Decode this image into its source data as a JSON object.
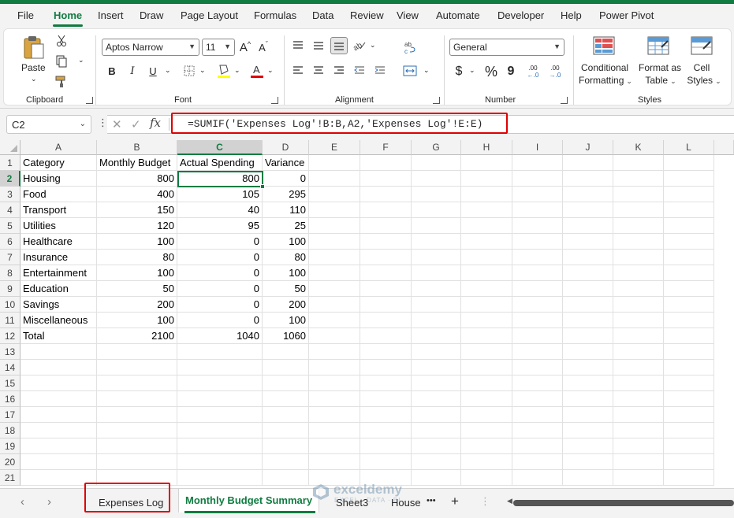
{
  "menu": {
    "tabs": [
      "File",
      "Home",
      "Insert",
      "Draw",
      "Page Layout",
      "Formulas",
      "Data",
      "Review",
      "View",
      "Automate",
      "Developer",
      "Help",
      "Power Pivot"
    ],
    "active": "Home"
  },
  "ribbon": {
    "clipboard": {
      "label": "Clipboard",
      "paste_label": "Paste"
    },
    "font": {
      "label": "Font",
      "font_name": "Aptos Narrow",
      "font_size": "11",
      "bold": "B",
      "italic": "I",
      "underline": "U",
      "grow": "A",
      "shrink": "A"
    },
    "alignment": {
      "label": "Alignment"
    },
    "number": {
      "label": "Number",
      "format": "General",
      "currency": "$",
      "percent": "%",
      "comma": "9",
      "inc_decimal": ".00",
      "dec_decimal": ".00"
    },
    "styles": {
      "label": "Styles",
      "conditional_line1": "Conditional",
      "conditional_line2": "Formatting",
      "format_table_line1": "Format as",
      "format_table_line2": "Table",
      "cell_styles_line1": "Cell",
      "cell_styles_line2": "Styles"
    }
  },
  "formula_bar": {
    "name_box": "C2",
    "fx": "fx",
    "formula": "=SUMIF('Expenses Log'!B:B,A2,'Expenses Log'!E:E)"
  },
  "grid": {
    "columns": [
      "A",
      "B",
      "C",
      "D",
      "E",
      "F",
      "G",
      "H",
      "I",
      "J",
      "K",
      "L"
    ],
    "row_numbers": [
      "1",
      "2",
      "3",
      "4",
      "5",
      "6",
      "7",
      "8",
      "9",
      "10",
      "11",
      "12",
      "13",
      "14",
      "15",
      "16",
      "17",
      "18",
      "19",
      "20",
      "21"
    ],
    "headers": [
      "Category",
      "Monthly Budget",
      "Actual Spending",
      "Variance"
    ],
    "rows": [
      [
        "Housing",
        "800",
        "800",
        "0"
      ],
      [
        "Food",
        "400",
        "105",
        "295"
      ],
      [
        "Transport",
        "150",
        "40",
        "110"
      ],
      [
        "Utilities",
        "120",
        "95",
        "25"
      ],
      [
        "Healthcare",
        "100",
        "0",
        "100"
      ],
      [
        "Insurance",
        "80",
        "0",
        "80"
      ],
      [
        "Entertainment",
        "100",
        "0",
        "100"
      ],
      [
        "Education",
        "50",
        "0",
        "50"
      ],
      [
        "Savings",
        "200",
        "0",
        "200"
      ],
      [
        "Miscellaneous",
        "100",
        "0",
        "100"
      ],
      [
        "Total",
        "2100",
        "1040",
        "1060"
      ]
    ]
  },
  "sheets": {
    "tabs": [
      "Expenses Log",
      "Monthly Budget Summary",
      "Sheet3",
      "House"
    ],
    "active": "Monthly Budget Summary",
    "more": "•••",
    "add": "+"
  },
  "watermark": {
    "name": "exceldemy",
    "sub": "EXCEL · DATA · BI"
  },
  "colors": {
    "accent": "#107c41",
    "highlight": "#e00000"
  }
}
